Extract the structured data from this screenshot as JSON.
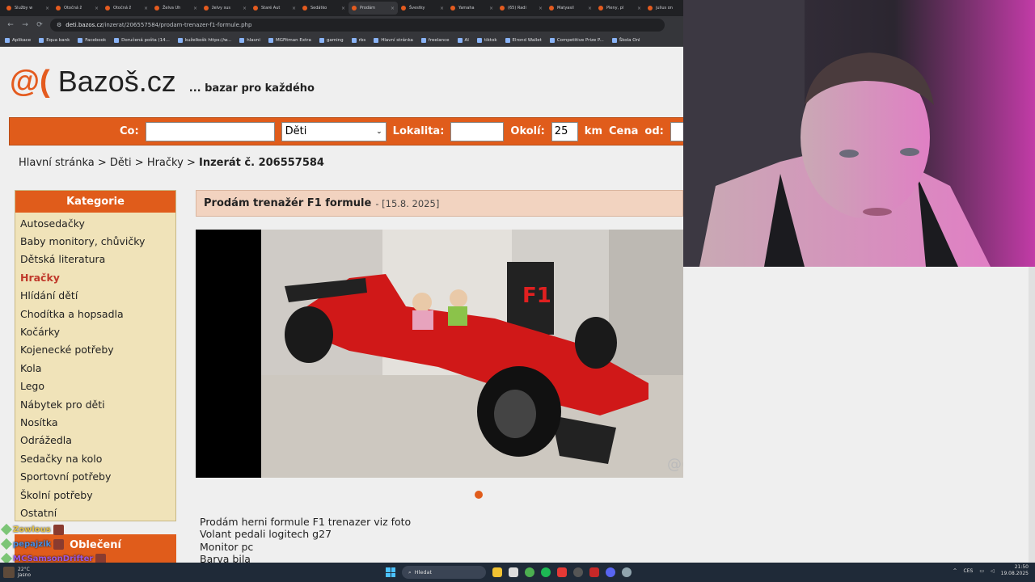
{
  "browser": {
    "tabs": [
      {
        "label": "Služby w"
      },
      {
        "label": "Otočná ž"
      },
      {
        "label": "Otočná ž"
      },
      {
        "label": "Želva Uh"
      },
      {
        "label": "želvy sus"
      },
      {
        "label": "Staré Aut"
      },
      {
        "label": "Sedátko"
      },
      {
        "label": "Prodám"
      },
      {
        "label": "Švestky"
      },
      {
        "label": "Yamaha"
      },
      {
        "label": "(65) Radi"
      },
      {
        "label": "Matyasil"
      },
      {
        "label": "Pleny, pl"
      },
      {
        "label": "julius on"
      }
    ],
    "url_host": "deti.bazos.cz",
    "url_path": "/inzerat/206557584/prodam-trenazer-f1-formule.php",
    "bookmarks": [
      "Aplikace",
      "Equa bank",
      "Facebook",
      "Doručená pošta (14...",
      "kuželkošk https://w...",
      "hlavni",
      "MGFitman Extra",
      "gaming",
      "rbs",
      "Hlavní stránka",
      "freelance",
      "AI",
      "tiktok",
      "Elrond Wallet",
      "Competitive Prize P...",
      "Škola Onl"
    ]
  },
  "site": {
    "logo_mark": "@(",
    "logo_name": "Bazoš.cz",
    "tagline": "... bazar pro každého"
  },
  "search": {
    "co_label": "Co:",
    "co_value": "",
    "category_value": "Děti",
    "lokalita_label": "Lokalita:",
    "lokalita_value": "",
    "okoli_label": "Okolí:",
    "okoli_value": "25",
    "km_label": "km",
    "cena_label": "Cena",
    "od_label": "od:"
  },
  "breadcrumb": {
    "home": "Hlavní stránka",
    "sep": ">",
    "section": "Děti",
    "category": "Hračky",
    "current": "Inzerát č. 206557584"
  },
  "categories": {
    "title": "Kategorie",
    "items": [
      "Autosedačky",
      "Baby monitory, chůvičky",
      "Dětská literatura",
      "Hračky",
      "Hlídání dětí",
      "Chodítka a hopsadla",
      "Kočárky",
      "Kojenecké potřeby",
      "Kola",
      "Lego",
      "Nábytek pro děti",
      "Nosítka",
      "Odrážedla",
      "Sedačky na kolo",
      "Sportovní potřeby",
      "Školní potřeby",
      "Ostatní"
    ],
    "active": "Hračky",
    "next_section": "Oblečení"
  },
  "ad": {
    "title": "Prodám trenažér F1 formule",
    "date": "- [15.8. 2025]",
    "watermark": "@( Bazos.cz",
    "description": [
      "Prodám herni formule F1 trenazer viz foto",
      "Volant pedali logitech g27",
      "Monitor pc",
      "Barva bila"
    ]
  },
  "chat": [
    {
      "user": "Zowlous",
      "color": "#e3c24a"
    },
    {
      "user": "pepajzik",
      "color": "#4a8ee3"
    },
    {
      "user": "MCSamsonDrifter",
      "color": "#9b59e3"
    }
  ],
  "taskbar": {
    "temp": "22°C",
    "weather": "Jasno",
    "search_placeholder": "Hledat",
    "lang": "CES",
    "time": "21:50",
    "date": "19.08.2025"
  },
  "colors": {
    "accent": "#e05c1b",
    "category_bg": "#f0e3b9",
    "title_bg": "#f2d3c0"
  }
}
